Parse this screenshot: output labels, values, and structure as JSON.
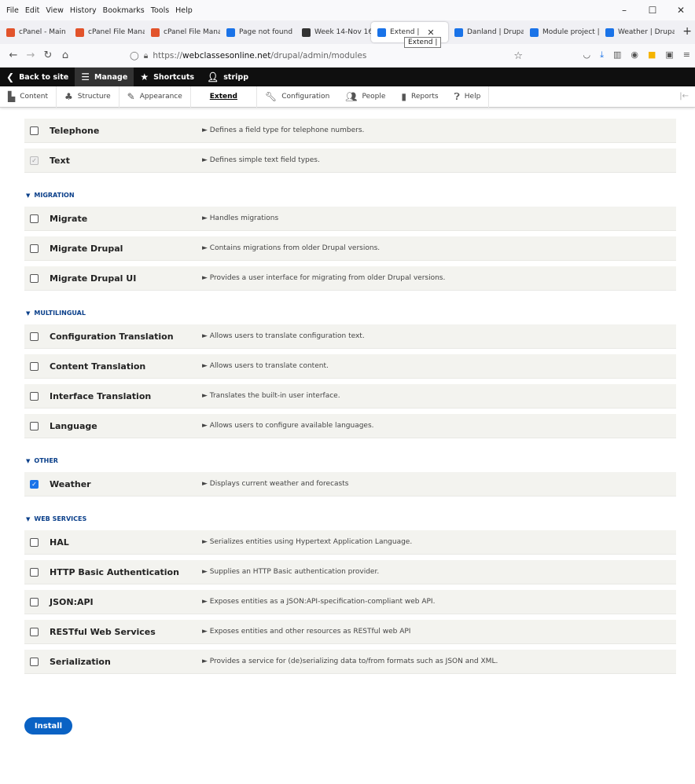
{
  "browser": {
    "menu": [
      "File",
      "Edit",
      "View",
      "History",
      "Bookmarks",
      "Tools",
      "Help"
    ],
    "tabs": [
      {
        "label": "cPanel - Main",
        "color": "#e2532b"
      },
      {
        "label": "cPanel File Mana",
        "color": "#e2532b"
      },
      {
        "label": "cPanel File Mana",
        "color": "#e2532b"
      },
      {
        "label": "Page not found |",
        "color": "#1a73e8"
      },
      {
        "label": "Week 14-Nov 16",
        "color": "#333333"
      },
      {
        "label": "Extend |",
        "color": "#1a73e8"
      },
      {
        "label": "Danland | Drupal",
        "color": "#1a73e8"
      },
      {
        "label": "Module project |",
        "color": "#1a73e8"
      },
      {
        "label": "Weather | Drupal",
        "color": "#1a73e8"
      }
    ],
    "tooltip": "Extend |",
    "url_prefix": "https://",
    "url_domain": "webclassesonline.net",
    "url_path": "/drupal/admin/modules"
  },
  "toolbar": {
    "back": "Back to site",
    "manage": "Manage",
    "shortcuts": "Shortcuts",
    "user": "stripp"
  },
  "tray": {
    "content": "Content",
    "structure": "Structure",
    "appearance": "Appearance",
    "extend": "Extend",
    "configuration": "Configuration",
    "people": "People",
    "reports": "Reports",
    "help": "Help"
  },
  "top_modules": [
    {
      "name": "Telephone",
      "desc": "► Defines a field type for telephone numbers.",
      "state": "unchecked"
    },
    {
      "name": "Text",
      "desc": "► Defines simple text field types.",
      "state": "disabled"
    }
  ],
  "packages": [
    {
      "title": "MIGRATION",
      "modules": [
        {
          "name": "Migrate",
          "desc": "► Handles migrations",
          "state": "unchecked"
        },
        {
          "name": "Migrate Drupal",
          "desc": "► Contains migrations from older Drupal versions.",
          "state": "unchecked"
        },
        {
          "name": "Migrate Drupal UI",
          "desc": "► Provides a user interface for migrating from older Drupal versions.",
          "state": "unchecked"
        }
      ]
    },
    {
      "title": "MULTILINGUAL",
      "modules": [
        {
          "name": "Configuration Translation",
          "desc": "► Allows users to translate configuration text.",
          "state": "unchecked"
        },
        {
          "name": "Content Translation",
          "desc": "► Allows users to translate content.",
          "state": "unchecked"
        },
        {
          "name": "Interface Translation",
          "desc": "► Translates the built-in user interface.",
          "state": "unchecked"
        },
        {
          "name": "Language",
          "desc": "► Allows users to configure available languages.",
          "state": "unchecked"
        }
      ]
    },
    {
      "title": "OTHER",
      "modules": [
        {
          "name": "Weather",
          "desc": "► Displays current weather and forecasts",
          "state": "checked"
        }
      ]
    },
    {
      "title": "WEB SERVICES",
      "modules": [
        {
          "name": "HAL",
          "desc": "► Serializes entities using Hypertext Application Language.",
          "state": "unchecked"
        },
        {
          "name": "HTTP Basic Authentication",
          "desc": "► Supplies an HTTP Basic authentication provider.",
          "state": "unchecked"
        },
        {
          "name": "JSON:API",
          "desc": "► Exposes entities as a JSON:API-specification-compliant web API.",
          "state": "unchecked"
        },
        {
          "name": "RESTful Web Services",
          "desc": "► Exposes entities and other resources as RESTful web API",
          "state": "unchecked"
        },
        {
          "name": "Serialization",
          "desc": "► Provides a service for (de)serializing data to/from formats such as JSON and XML.",
          "state": "unchecked"
        }
      ]
    }
  ],
  "install_label": "Install"
}
